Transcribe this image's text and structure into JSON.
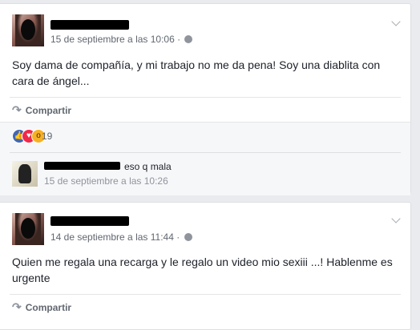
{
  "posts": [
    {
      "timestamp": "15 de septiembre a las 10:06",
      "sep": "·",
      "text": "Soy dama de compañía, y mi trabajo no me da pena! Soy una diablita con cara de ángel...",
      "share_label": "Compartir",
      "reaction_count": "19",
      "reactions": [
        "like-icon",
        "love-icon",
        "wow-icon"
      ],
      "comment": {
        "text": "eso q mala",
        "timestamp": "15 de septiembre a las 10:26"
      }
    },
    {
      "timestamp": "14 de septiembre a las 11:44",
      "sep": "·",
      "text": "Quien me regala una recarga y le regalo un video mio sexiii ...! Hablenme es urgente",
      "share_label": "Compartir"
    }
  ],
  "colors": {
    "background": "#e9ebee",
    "card": "#ffffff",
    "meta_text": "#616770",
    "like": "#4267b2",
    "love": "#f0284a",
    "wow": "#f7b125"
  }
}
